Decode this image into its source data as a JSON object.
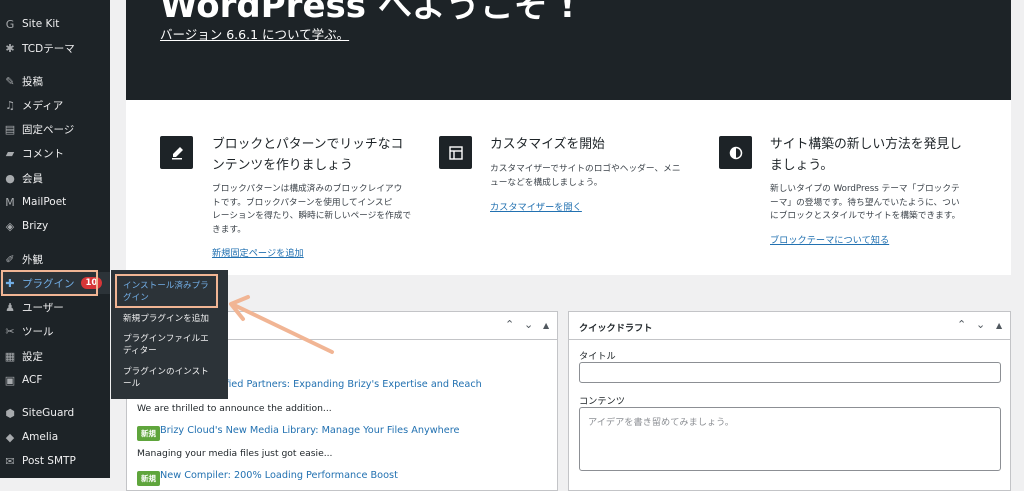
{
  "sidebar": {
    "items": [
      {
        "label": "Site Kit",
        "icon": "site-kit-icon"
      },
      {
        "label": "TCDテーマ",
        "icon": "gear-icon"
      },
      {
        "label": "投稿",
        "icon": "pin-icon"
      },
      {
        "label": "メディア",
        "icon": "media-icon"
      },
      {
        "label": "固定ページ",
        "icon": "page-icon"
      },
      {
        "label": "コメント",
        "icon": "comment-icon"
      },
      {
        "label": "会員",
        "icon": "members-icon"
      },
      {
        "label": "MailPoet",
        "icon": "mailpoet-icon"
      },
      {
        "label": "Brizy",
        "icon": "brizy-icon"
      },
      {
        "label": "外観",
        "icon": "brush-icon"
      },
      {
        "label": "プラグイン",
        "icon": "plugin-icon",
        "badge": "10"
      },
      {
        "label": "ユーザー",
        "icon": "user-icon"
      },
      {
        "label": "ツール",
        "icon": "wrench-icon"
      },
      {
        "label": "設定",
        "icon": "settings-icon"
      },
      {
        "label": "ACF",
        "icon": "acf-icon"
      },
      {
        "label": "SiteGuard",
        "icon": "siteguard-icon"
      },
      {
        "label": "Amelia",
        "icon": "amelia-icon"
      },
      {
        "label": "Post SMTP",
        "icon": "mail-icon"
      }
    ]
  },
  "flyout": {
    "items": [
      "インストール済みプラ\nグイン",
      "新規プラグインを追加",
      "プラグインファイルエ\nディター",
      "プラグインのインスト\nール"
    ]
  },
  "welcome": {
    "title": "WordPress へようこそ !",
    "version_link": "バージョン 6.6.1 について学ぶ。",
    "columns": [
      {
        "icon": "pencil-icon",
        "title": "ブロックとパターンでリッチなコ\nンテンツを作りましょう",
        "desc": "ブロックパターンは構成済みのブロックレイアウ\nトです。ブロックパターンを使用してインスピ\nレーションを得たり、瞬時に新しいページを作成で\nきます。",
        "link": "新規固定ページを追加"
      },
      {
        "icon": "layout-icon",
        "title": "カスタマイズを開始",
        "desc": "カスタマイザーでサイトのロゴやヘッダー、メニ\nューなどを構成しましょう。",
        "link": "カスタマイザーを開く"
      },
      {
        "icon": "contrast-icon",
        "title": "サイト構築の新しい方法を発見し\nましょう。",
        "desc": "新しいタイプの WordPress テーマ「ブロックテ\nーマ」の登場です。待ち望んでいたように、つい\nにブロックとスタイルでサイトを構築できます。",
        "link": "ブロックテーマについて知る"
      }
    ]
  },
  "news": {
    "items": [
      {
        "badge": "",
        "title": "ar Certified Partners: Expanding Brizy's Expertise and Reach",
        "excerpt": "We are thrilled to announce the addition..."
      },
      {
        "badge": "新規",
        "title": "Brizy Cloud's New Media Library: Manage Your Files Anywhere",
        "excerpt": "Managing your media files just got easie..."
      },
      {
        "badge": "新規",
        "title": "New Compiler: 200% Loading Performance Boost",
        "excerpt": ""
      }
    ]
  },
  "quickdraft": {
    "title": "クイックドラフト",
    "title_label": "タイトル",
    "content_label": "コンテンツ",
    "content_placeholder": "アイデアを書き留めてみましょう。"
  },
  "colors": {
    "sidebar_bg": "#1d2327",
    "link": "#2271b1",
    "accent_highlight": "#f1b594",
    "badge": "#d63638",
    "new_badge": "#5fa53c"
  }
}
